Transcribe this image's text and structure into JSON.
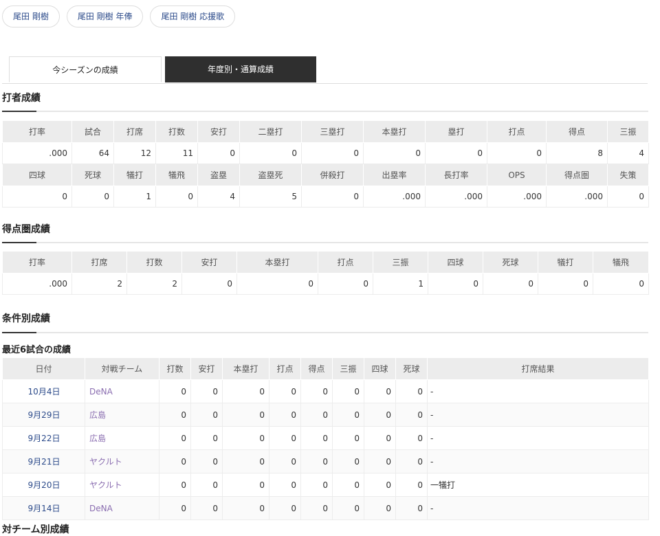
{
  "chips": [
    "尾田 剛樹",
    "尾田 剛樹 年俸",
    "尾田 剛樹 応援歌"
  ],
  "tabs": [
    "今シーズンの成績",
    "年度別・通算成績"
  ],
  "batting": {
    "title": "打者成績",
    "row1_headers": [
      "打率",
      "試合",
      "打席",
      "打数",
      "安打",
      "二塁打",
      "三塁打",
      "本塁打",
      "塁打",
      "打点",
      "得点",
      "三振"
    ],
    "row1_values": [
      ".000",
      "64",
      "12",
      "11",
      "0",
      "0",
      "0",
      "0",
      "0",
      "0",
      "8",
      "4"
    ],
    "row2_headers": [
      "四球",
      "死球",
      "犠打",
      "犠飛",
      "盗塁",
      "盗塁死",
      "併殺打",
      "出塁率",
      "長打率",
      "OPS",
      "得点圏",
      "失策"
    ],
    "row2_values": [
      "0",
      "0",
      "1",
      "0",
      "4",
      "5",
      "0",
      ".000",
      ".000",
      ".000",
      ".000",
      "0"
    ]
  },
  "scoring": {
    "title": "得点圏成績",
    "headers": [
      "打率",
      "打席",
      "打数",
      "安打",
      "本塁打",
      "打点",
      "三振",
      "四球",
      "死球",
      "犠打",
      "犠飛"
    ],
    "values": [
      ".000",
      "2",
      "2",
      "0",
      "0",
      "0",
      "1",
      "0",
      "0",
      "0",
      "0"
    ]
  },
  "conditions": {
    "title": "条件別成績",
    "subtitle": "最近6試合の成績",
    "headers": [
      "日付",
      "対戦チーム",
      "打数",
      "安打",
      "本塁打",
      "打点",
      "得点",
      "三振",
      "四球",
      "死球",
      "打席結果"
    ],
    "rows": [
      [
        "10月4日",
        "DeNA",
        "0",
        "0",
        "0",
        "0",
        "0",
        "0",
        "0",
        "0",
        "-"
      ],
      [
        "9月29日",
        "広島",
        "0",
        "0",
        "0",
        "0",
        "0",
        "0",
        "0",
        "0",
        "-"
      ],
      [
        "9月22日",
        "広島",
        "0",
        "0",
        "0",
        "0",
        "0",
        "0",
        "0",
        "0",
        "-"
      ],
      [
        "9月21日",
        "ヤクルト",
        "0",
        "0",
        "0",
        "0",
        "0",
        "0",
        "0",
        "0",
        "-"
      ],
      [
        "9月20日",
        "ヤクルト",
        "0",
        "0",
        "0",
        "0",
        "0",
        "0",
        "0",
        "0",
        "一犠打"
      ],
      [
        "9月14日",
        "DeNA",
        "0",
        "0",
        "0",
        "0",
        "0",
        "0",
        "0",
        "0",
        "-"
      ]
    ]
  },
  "next_section_partial": "対チーム別成績"
}
